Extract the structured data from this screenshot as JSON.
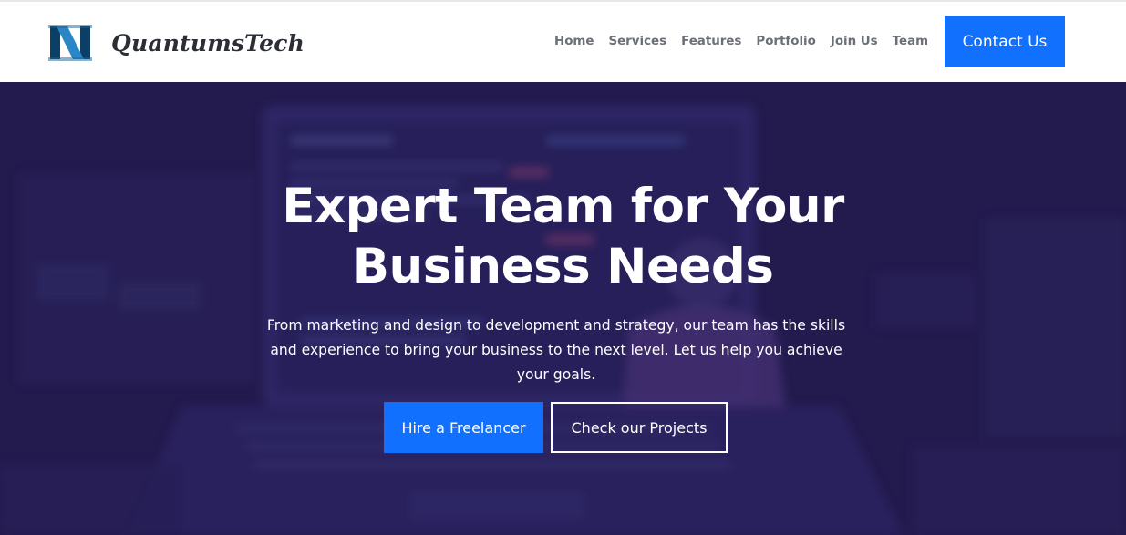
{
  "brand": {
    "name": "QuantumsTech",
    "logo_icon": "n-monogram-logo-icon",
    "colors": {
      "mark_dark": "#0b3f66",
      "mark_light": "#2a86c7"
    }
  },
  "nav": {
    "items": [
      {
        "label": "Home"
      },
      {
        "label": "Services"
      },
      {
        "label": "Features"
      },
      {
        "label": "Portfolio"
      },
      {
        "label": "Join Us"
      },
      {
        "label": "Team"
      }
    ],
    "cta_label": "Contact Us"
  },
  "hero": {
    "title_line1": "Expert Team for Your",
    "title_line2": "Business Needs",
    "description": "From marketing and design to development and strategy, our team has the skills and experience to bring your business to the next level. Let us help you achieve your goals.",
    "primary_button": "Hire a Freelancer",
    "secondary_button": "Check our Projects",
    "background_image": "blurred-laptop-developer-illustration",
    "overlay_color": "#231a4e"
  },
  "colors": {
    "accent": "#1170fd",
    "nav_text": "#6b6f76",
    "brand_text": "#2b2e35",
    "hero_text": "#ffffff"
  }
}
